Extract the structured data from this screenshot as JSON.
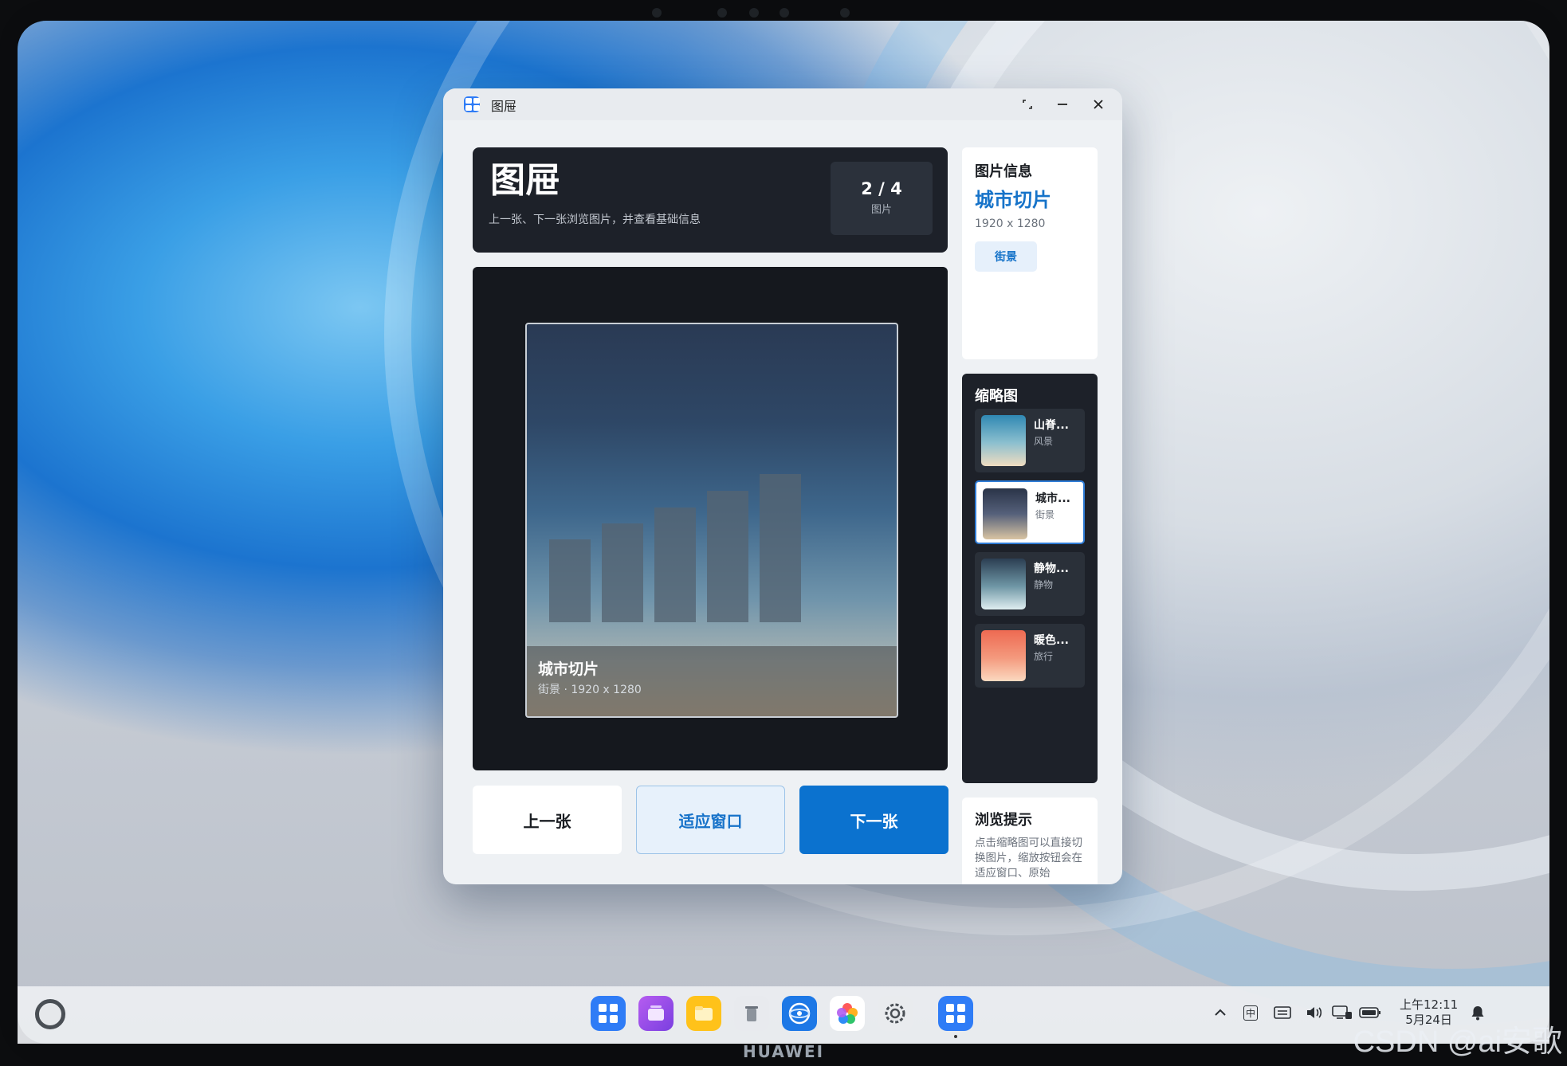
{
  "device": {
    "brand": "HUAWEI",
    "watermark": "CSDN @ai安歌"
  },
  "window": {
    "title": "图屉",
    "controls": {
      "restore_icon": "restore-icon",
      "minimize_icon": "minimize-icon",
      "close_icon": "close-icon"
    }
  },
  "header": {
    "title": "图屉",
    "subtitle": "上一张、下一张浏览图片，并查看基础信息",
    "counter": {
      "value": "2 / 4",
      "label": "图片"
    }
  },
  "viewer": {
    "caption_title": "城市切片",
    "caption_sub": "街景 · 1920 x 1280"
  },
  "actions": {
    "prev": "上一张",
    "fit": "适应窗口",
    "next": "下一张"
  },
  "info": {
    "heading": "图片信息",
    "name": "城市切片",
    "dimensions": "1920 x 1280",
    "tag": "街景"
  },
  "thumbnails": {
    "heading": "缩略图",
    "items": [
      {
        "name": "山脊...",
        "category": "风景",
        "active": false
      },
      {
        "name": "城市...",
        "category": "街景",
        "active": true
      },
      {
        "name": "静物...",
        "category": "静物",
        "active": false
      },
      {
        "name": "暖色...",
        "category": "旅行",
        "active": false
      }
    ]
  },
  "tips": {
    "heading": "浏览提示",
    "body": "点击缩略图可以直接切换图片，缩放按钮会在适应窗口、原始"
  },
  "taskbar": {
    "ime": "中",
    "clock_time": "上午12:11",
    "clock_date": "5月24日"
  },
  "colors": {
    "accent": "#0b72cf",
    "dark_card": "#1d2129",
    "window_bg": "#eef1f4"
  }
}
